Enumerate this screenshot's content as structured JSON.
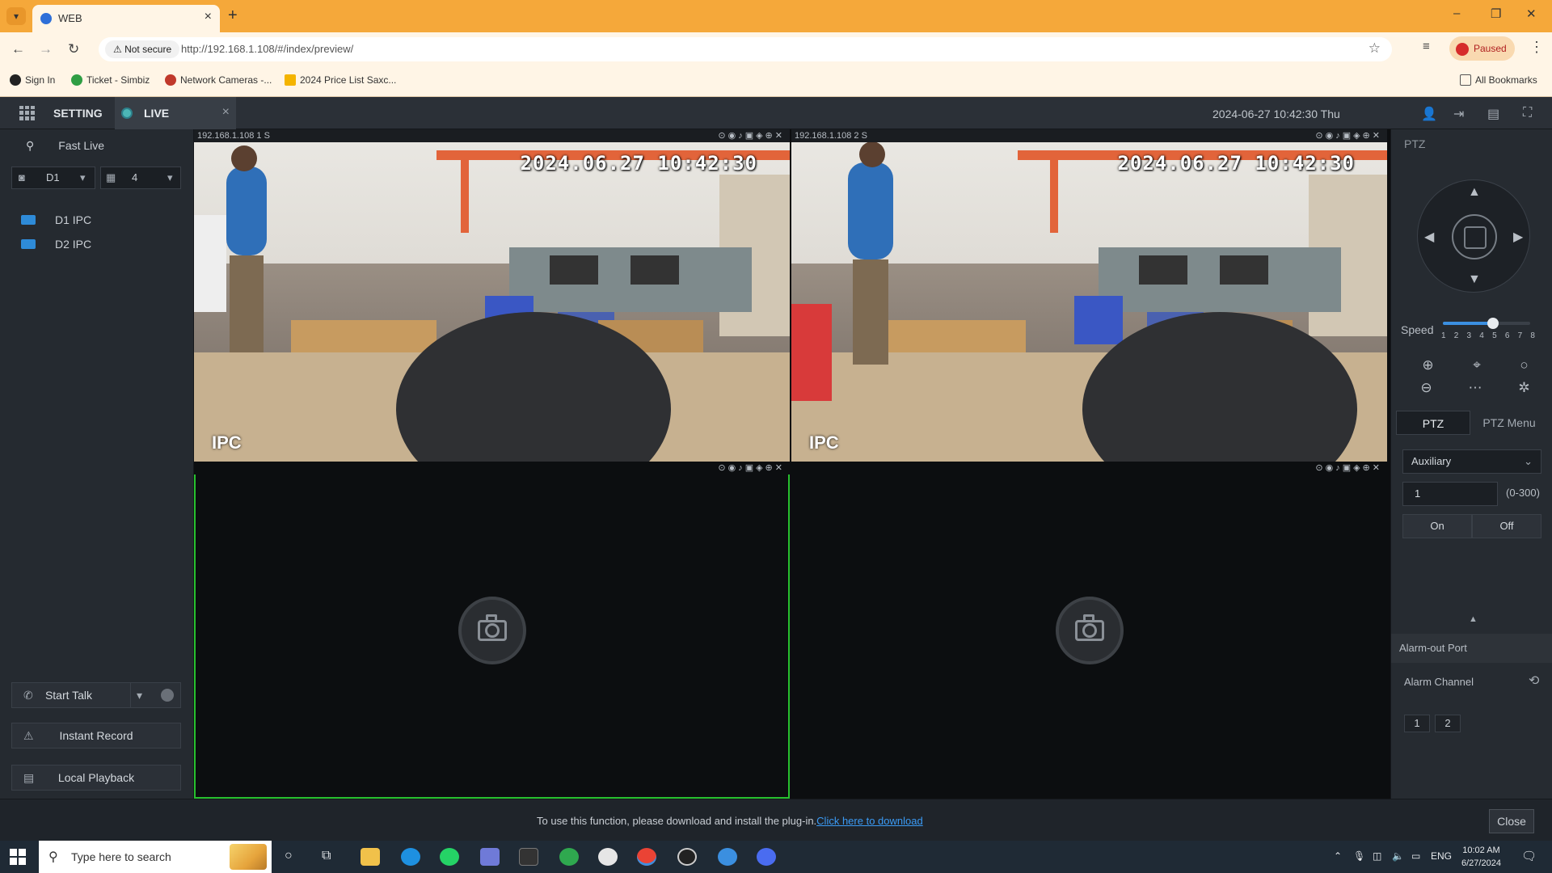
{
  "browser": {
    "tab_title": "WEB",
    "url_security": "Not secure",
    "url": "http://192.168.1.108/#/index/preview/",
    "profile_status": "Paused",
    "bookmarks": [
      "Sign In",
      "Ticket - Simbiz",
      "Network Cameras -...",
      "2024 Price List Saxc..."
    ],
    "all_bookmarks": "All Bookmarks"
  },
  "app": {
    "setting_label": "SETTING",
    "live_label": "LIVE",
    "datetime": "2024-06-27 10:42:30 Thu"
  },
  "sidebar": {
    "fast_live": "Fast Live",
    "stream_select": "D1",
    "layout_select": "4",
    "devices": [
      "D1 IPC",
      "D2 IPC"
    ],
    "start_talk": "Start Talk",
    "instant_record": "Instant Record",
    "local_playback": "Local Playback"
  },
  "cameras": [
    {
      "label": "192.168.1.108 1 S",
      "osd_time": "2024.06.27 10:42:30",
      "osd_name": "IPC"
    },
    {
      "label": "192.168.1.108 2 S",
      "osd_time": "2024.06.27 10:42:30",
      "osd_name": "IPC"
    },
    {
      "label": ""
    },
    {
      "label": ""
    }
  ],
  "ptz": {
    "title": "PTZ",
    "speed_label": "Speed",
    "speed_ticks": [
      "1",
      "2",
      "3",
      "4",
      "5",
      "6",
      "7",
      "8"
    ],
    "speed_value": 5,
    "tab_ptz": "PTZ",
    "tab_menu": "PTZ Menu",
    "aux_select": "Auxiliary",
    "aux_value": "1",
    "aux_range": "(0-300)",
    "on": "On",
    "off": "Off",
    "alarm_out_port": "Alarm-out Port",
    "alarm_channel": "Alarm Channel",
    "alarm_channels": [
      "1",
      "2"
    ]
  },
  "plugin": {
    "message": "To use this function, please download and install the plug-in.",
    "link": "Click here to download",
    "close": "Close"
  },
  "taskbar": {
    "search_placeholder": "Type here to search",
    "lang": "ENG",
    "time": "10:02 AM",
    "date": "6/27/2024"
  },
  "colors": {
    "browser_accent": "#f5a83a",
    "selected_cell": "#27c02e",
    "link": "#3b9bf5"
  }
}
